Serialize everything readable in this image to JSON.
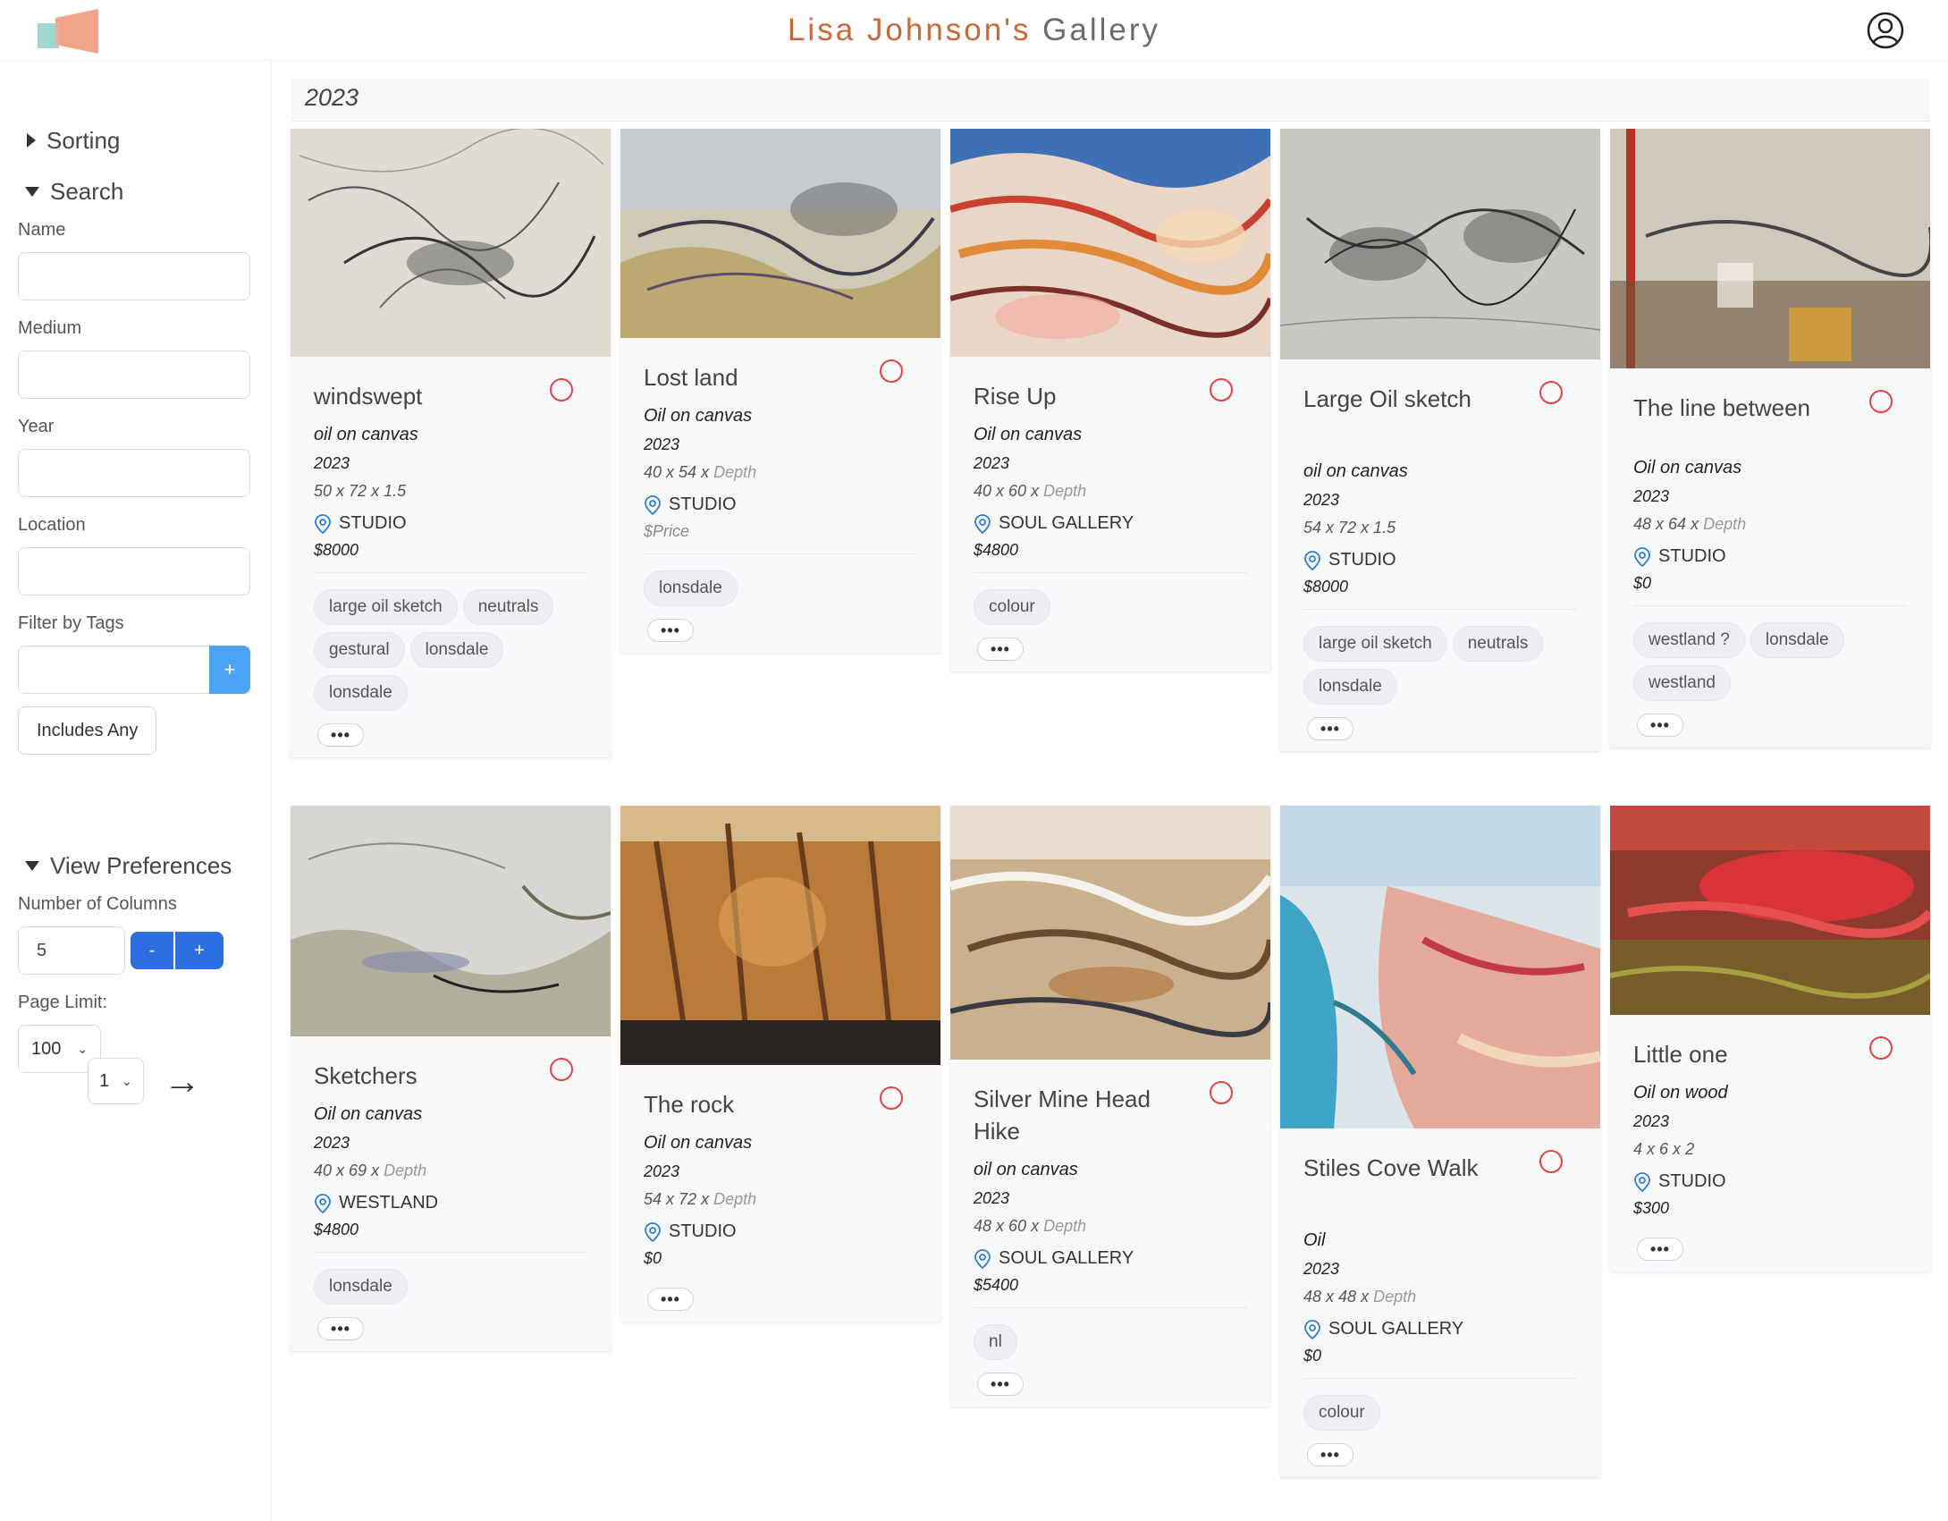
{
  "header": {
    "title_part1": "Lisa Johnson's",
    "title_part2": "Gallery"
  },
  "sidebar": {
    "sorting_label": "Sorting",
    "search_label": "Search",
    "name_label": "Name",
    "medium_label": "Medium",
    "year_label": "Year",
    "location_label": "Location",
    "filter_tags_label": "Filter by Tags",
    "add_tag_label": "+",
    "includes_any_label": "Includes Any",
    "view_prefs_label": "View Preferences",
    "num_columns_label": "Number of Columns",
    "num_columns_value": "5",
    "minus_label": "-",
    "plus_label": "+",
    "page_limit_label": "Page Limit:",
    "page_limit_value": "100",
    "page_number": "1"
  },
  "group_year": "2023",
  "colors": {
    "accent_title": "#c8683a",
    "primary_button": "#2d6fe0",
    "tag_add_button": "#4da3f5",
    "radio_border": "#e04545",
    "location_icon": "#2f7fd0"
  },
  "cards": [
    {
      "title": "windswept",
      "medium": "oil on canvas",
      "year": "2023",
      "w": "50",
      "h": "72",
      "depth": "1.5",
      "location": "STUDIO",
      "price": "$8000",
      "tags": [
        "large oil sketch",
        "neutrals",
        "gestural",
        "lonsdale",
        "lonsdale"
      ]
    },
    {
      "title": "Lost land",
      "medium": "Oil on canvas",
      "year": "2023",
      "w": "40",
      "h": "54",
      "depth": "Depth",
      "location": "STUDIO",
      "price": "$Price",
      "tags": [
        "lonsdale"
      ]
    },
    {
      "title": "Rise Up",
      "medium": "Oil on canvas",
      "year": "2023",
      "w": "40",
      "h": "60",
      "depth": "Depth",
      "location": "SOUL GALLERY",
      "price": "$4800",
      "tags": [
        "colour"
      ]
    },
    {
      "title": "Large Oil sketch",
      "medium": "oil on canvas",
      "year": "2023",
      "w": "54",
      "h": "72",
      "depth": "1.5",
      "location": "STUDIO",
      "price": "$8000",
      "tags": [
        "large oil sketch",
        "neutrals",
        "lonsdale"
      ]
    },
    {
      "title": "The line between",
      "medium": "Oil on canvas",
      "year": "2023",
      "w": "48",
      "h": "64",
      "depth": "Depth",
      "location": "STUDIO",
      "price": "$0",
      "tags": [
        "westland ?",
        "lonsdale",
        "westland"
      ]
    },
    {
      "title": "Sketchers",
      "medium": "Oil on canvas",
      "year": "2023",
      "w": "40",
      "h": "69",
      "depth": "Depth",
      "location": "WESTLAND",
      "price": "$4800",
      "tags": [
        "lonsdale"
      ]
    },
    {
      "title": "The rock",
      "medium": "Oil on canvas",
      "year": "2023",
      "w": "54",
      "h": "72",
      "depth": "Depth",
      "location": "STUDIO",
      "price": "$0",
      "tags": []
    },
    {
      "title": "Silver Mine Head Hike",
      "medium": "oil on canvas",
      "year": "2023",
      "w": "48",
      "h": "60",
      "depth": "Depth",
      "location": "SOUL GALLERY",
      "price": "$5400",
      "tags": [
        "nl"
      ]
    },
    {
      "title": "Stiles Cove Walk",
      "medium": "Oil",
      "year": "2023",
      "w": "48",
      "h": "48",
      "depth": "Depth",
      "location": "SOUL GALLERY",
      "price": "$0",
      "tags": [
        "colour"
      ]
    },
    {
      "title": "Little one",
      "medium": "Oil on wood",
      "year": "2023",
      "w": "4",
      "h": "6",
      "depth": "2",
      "location": "STUDIO",
      "price": "$300",
      "tags": []
    }
  ]
}
